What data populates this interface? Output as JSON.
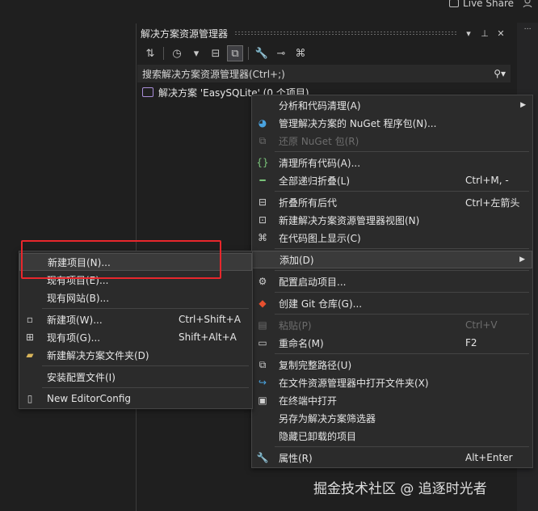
{
  "top": {
    "live_share": "Live Share"
  },
  "panel": {
    "title": "解决方案资源管理器",
    "title_buttons": [
      "▾",
      "⊥",
      "✕"
    ],
    "search_placeholder": "搜索解决方案资源管理器(Ctrl+;)",
    "tree_root": "解决方案 'EasySQLite' (0 个项目)"
  },
  "main_menu": [
    {
      "label": "分析和代码清理(A)",
      "shortcut": "",
      "icon": "",
      "disabled": false,
      "submenu": true
    },
    {
      "label": "管理解决方案的 NuGet 程序包(N)...",
      "shortcut": "",
      "icon": "nuget-icon",
      "disabled": false
    },
    {
      "label": "还原 NuGet 包(R)",
      "shortcut": "",
      "icon": "restore-icon",
      "disabled": true
    },
    {
      "label": "清理所有代码(A)...",
      "shortcut": "",
      "icon": "code-cleanup-icon",
      "disabled": false
    },
    {
      "label": "全部递归折叠(L)",
      "shortcut": "Ctrl+M, -",
      "icon": "collapse-all-icon",
      "disabled": false
    },
    {
      "label": "折叠所有后代",
      "shortcut": "Ctrl+左箭头",
      "icon": "collapse-icon",
      "disabled": false
    },
    {
      "label": "新建解决方案资源管理器视图(N)",
      "shortcut": "",
      "icon": "new-view-icon",
      "disabled": false
    },
    {
      "label": "在代码图上显示(C)",
      "shortcut": "",
      "icon": "code-map-icon",
      "disabled": false
    },
    {
      "label": "添加(D)",
      "shortcut": "",
      "icon": "",
      "disabled": false,
      "submenu": true
    },
    {
      "label": "配置启动项目...",
      "shortcut": "",
      "icon": "gear-icon",
      "disabled": false
    },
    {
      "label": "创建 Git 仓库(G)...",
      "shortcut": "",
      "icon": "git-icon",
      "disabled": false
    },
    {
      "label": "粘贴(P)",
      "shortcut": "Ctrl+V",
      "icon": "paste-icon",
      "disabled": true
    },
    {
      "label": "重命名(M)",
      "shortcut": "F2",
      "icon": "rename-icon",
      "disabled": false
    },
    {
      "label": "复制完整路径(U)",
      "shortcut": "",
      "icon": "copy-icon",
      "disabled": false
    },
    {
      "label": "在文件资源管理器中打开文件夹(X)",
      "shortcut": "",
      "icon": "open-folder-icon",
      "disabled": false
    },
    {
      "label": "在终端中打开",
      "shortcut": "",
      "icon": "terminal-icon",
      "disabled": false
    },
    {
      "label": "另存为解决方案筛选器",
      "shortcut": "",
      "icon": "",
      "disabled": false
    },
    {
      "label": "隐藏已卸载的项目",
      "shortcut": "",
      "icon": "",
      "disabled": false
    },
    {
      "label": "属性(R)",
      "shortcut": "Alt+Enter",
      "icon": "wrench-icon",
      "disabled": false
    }
  ],
  "sub_menu": [
    {
      "label": "新建项目(N)...",
      "shortcut": "",
      "icon": ""
    },
    {
      "label": "现有项目(E)...",
      "shortcut": "",
      "icon": ""
    },
    {
      "label": "现有网站(B)...",
      "shortcut": "",
      "icon": ""
    },
    {
      "label": "新建项(W)...",
      "shortcut": "Ctrl+Shift+A",
      "icon": "new-item-icon"
    },
    {
      "label": "现有项(G)...",
      "shortcut": "Shift+Alt+A",
      "icon": "existing-item-icon"
    },
    {
      "label": "新建解决方案文件夹(D)",
      "shortcut": "",
      "icon": "new-folder-icon"
    },
    {
      "label": "安装配置文件(I)",
      "shortcut": "",
      "icon": ""
    },
    {
      "label": "New EditorConfig",
      "shortcut": "",
      "icon": "editorconfig-icon"
    }
  ],
  "watermark": "掘金技术社区 @ 追逐时光者"
}
